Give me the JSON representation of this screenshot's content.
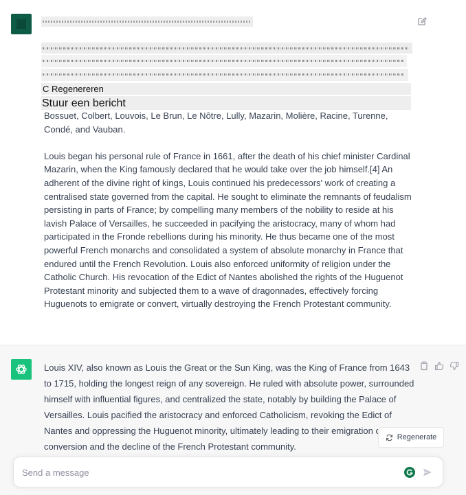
{
  "user_message": {
    "overlay_regenerate": "C Regenereren",
    "overlay_prompt": "Stuur een bericht",
    "paragraphs": [
      "Bossuet, Colbert, Louvois, Le Brun, Le Nôtre, Lully, Mazarin, Molière, Racine, Turenne, Condé, and Vauban.",
      "Louis began his personal rule of France in 1661, after the death of his chief minister Cardinal Mazarin, when the King famously declared that he would take over the job himself.[4] An adherent of the divine right of kings, Louis continued his predecessors' work of creating a centralised state governed from the capital. He sought to eliminate the remnants of feudalism persisting in parts of France; by compelling many members of the nobility to reside at his lavish Palace of Versailles, he succeeded in pacifying the aristocracy, many of whom had participated in the Fronde rebellions during his minority. He thus became one of the most powerful French monarchs and consolidated a system of absolute monarchy in France that endured until the French Revolution. Louis also enforced uniformity of religion under the Catholic Church. His revocation of the Edict of Nantes abolished the rights of the Huguenot Protestant minority and subjected them to a wave of dragonnades, effectively forcing Huguenots to emigrate or convert, virtually destroying the French Protestant community."
    ]
  },
  "assistant_message": {
    "text": "Louis XIV, also known as Louis the Great or the Sun King, was the King of France from 1643 to 1715, holding the longest reign of any sovereign. He ruled with absolute power, surrounded himself with influential figures, and centralized the state, notably by building the Palace of Versailles. Louis pacified the aristocracy and enforced Catholicism, revoking the Edict of Nantes and oppressing the Huguenot minority, ultimately leading to their emigration or conversion and the decline of the French Protestant community."
  },
  "regenerate_label": "Regenerate",
  "composer": {
    "placeholder": "Send a message"
  },
  "colors": {
    "accent": "#19c37d",
    "user_avatar": "#0e5c46",
    "panel": "#f7f7f8"
  },
  "icons": [
    "edit-icon",
    "copy-icon",
    "thumbs-up-icon",
    "thumbs-down-icon",
    "refresh-icon",
    "grammarly-icon",
    "send-icon",
    "openai-logo-icon"
  ]
}
